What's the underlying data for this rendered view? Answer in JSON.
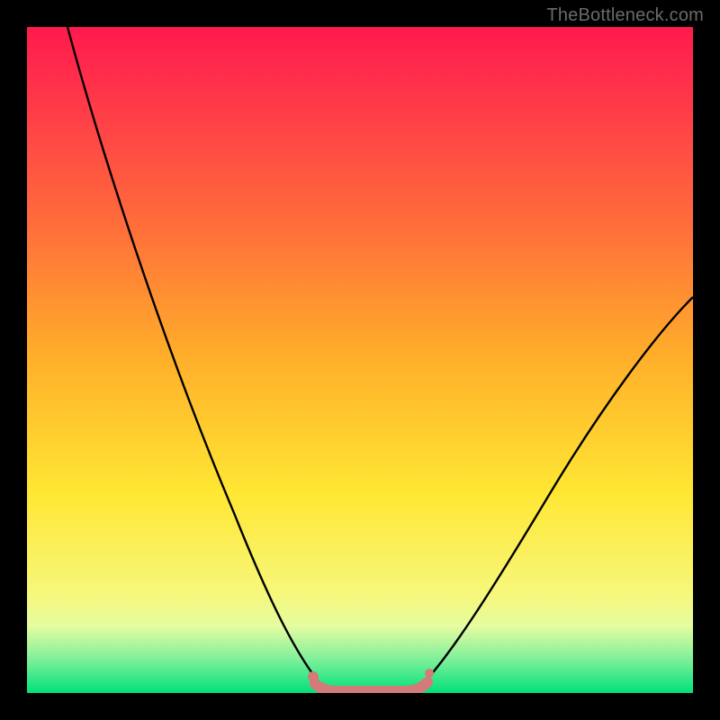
{
  "attribution": "TheBottleneck.com",
  "colors": {
    "frame_background": "#000000",
    "gradient_top": "#ff1a4d",
    "gradient_bottom": "#00e07a",
    "curve_stroke": "#000000",
    "bottom_marker": "#d47a7a",
    "attribution_text": "#6a6a6a"
  },
  "chart_data": {
    "type": "line",
    "title": "",
    "xlabel": "",
    "ylabel": "",
    "xlim": [
      0,
      100
    ],
    "ylim": [
      0,
      100
    ],
    "series": [
      {
        "name": "left-curve",
        "x": [
          6,
          10,
          15,
          20,
          25,
          30,
          35,
          40,
          43,
          45
        ],
        "values": [
          100,
          88,
          74,
          60,
          46,
          32,
          20,
          9,
          3,
          0
        ]
      },
      {
        "name": "right-curve",
        "x": [
          59,
          62,
          66,
          72,
          80,
          88,
          95,
          100
        ],
        "values": [
          0,
          3,
          8,
          18,
          31,
          44,
          53,
          59
        ]
      },
      {
        "name": "bottom-flat",
        "x": [
          45,
          48,
          52,
          56,
          59
        ],
        "values": [
          0,
          0,
          0,
          0,
          0
        ]
      }
    ],
    "notes": "Values are visual estimates from an unlabeled gradient plot; y=0 is the green bottom edge, y=100 the top edge."
  }
}
